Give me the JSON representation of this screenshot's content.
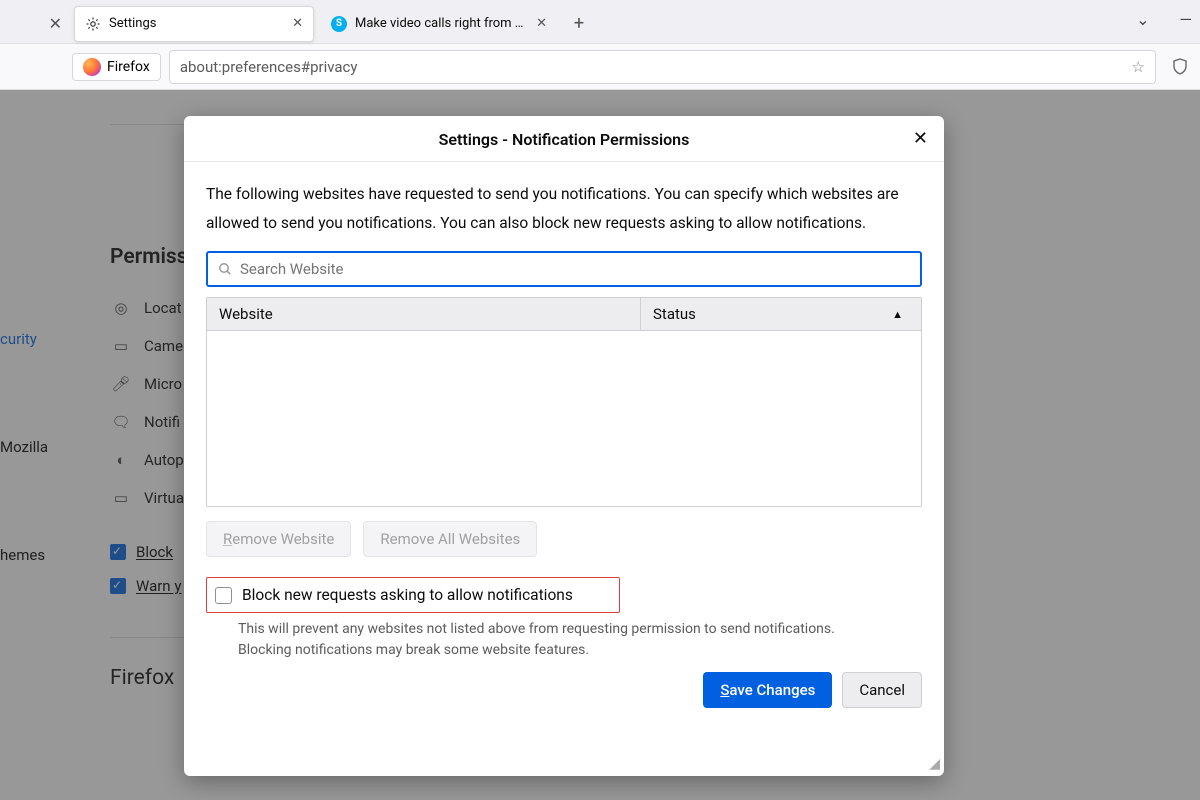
{
  "tabs": {
    "blank_close": "✕",
    "settings_label": "Settings",
    "skype_label": "Make video calls right from you",
    "newtab": "+"
  },
  "toolbar": {
    "firefox_label": "Firefox",
    "url": "about:preferences#privacy"
  },
  "sidebar": {
    "security": "curity",
    "mozilla": "Mozilla",
    "themes": "hemes"
  },
  "bg": {
    "permissions_heading": "Permiss",
    "location": "Locat",
    "camera": "Came",
    "microphone": "Micro",
    "notifications": "Notifi",
    "autoplay": "Autop",
    "vr": "Virtua",
    "block_popups": "Block",
    "warn_addons": "Warn y",
    "firefox_heading": "Firefox"
  },
  "dialog": {
    "title": "Settings - Notification Permissions",
    "description": "The following websites have requested to send you notifications. You can specify which websites are allowed to send you notifications. You can also block new requests asking to allow notifications.",
    "search_placeholder": "Search Website",
    "col_website": "Website",
    "col_status": "Status",
    "remove_website": "Remove Website",
    "remove_all": "Remove All Websites",
    "block_new_label": "Block new requests asking to allow notifications",
    "block_hint": "This will prevent any websites not listed above from requesting permission to send notifications. Blocking notifications may break some website features.",
    "save": "Save Changes",
    "cancel": "Cancel"
  },
  "window": {
    "menu": "⌄",
    "min": "—"
  }
}
